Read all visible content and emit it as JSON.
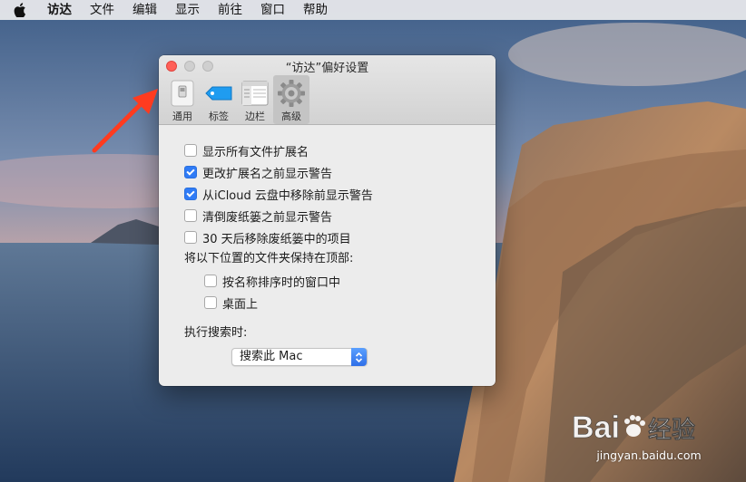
{
  "menubar": {
    "items": [
      {
        "label": "访达",
        "bold": true
      },
      {
        "label": "文件"
      },
      {
        "label": "编辑"
      },
      {
        "label": "显示"
      },
      {
        "label": "前往"
      },
      {
        "label": "窗口"
      },
      {
        "label": "帮助"
      }
    ]
  },
  "window": {
    "title": "“访达”偏好设置",
    "tabs": [
      {
        "label": "通用",
        "icon": "general-icon",
        "active": false
      },
      {
        "label": "标签",
        "icon": "tag-icon",
        "active": false
      },
      {
        "label": "边栏",
        "icon": "sidebar-icon",
        "active": false
      },
      {
        "label": "高级",
        "icon": "gear-icon",
        "active": true
      }
    ]
  },
  "options": [
    {
      "label": "显示所有文件扩展名",
      "checked": false
    },
    {
      "label": "更改扩展名之前显示警告",
      "checked": true
    },
    {
      "label": "从iCloud 云盘中移除前显示警告",
      "checked": true
    },
    {
      "label": "清倒废纸篓之前显示警告",
      "checked": false
    },
    {
      "label": "30 天后移除废纸篓中的项目",
      "checked": false
    }
  ],
  "folders_on_top": {
    "heading": "将以下位置的文件夹保持在顶部:",
    "items": [
      {
        "label": "按名称排序时的窗口中",
        "checked": false
      },
      {
        "label": "桌面上",
        "checked": false
      }
    ]
  },
  "search": {
    "heading": "执行搜索时:",
    "selected": "搜索此 Mac"
  },
  "watermark": {
    "brand": "Baidu经验",
    "url": "jingyan.baidu.com"
  },
  "colors": {
    "accent": "#2f7bf6",
    "close_button": "#ff5f57",
    "annotation": "#ff3b1f"
  }
}
